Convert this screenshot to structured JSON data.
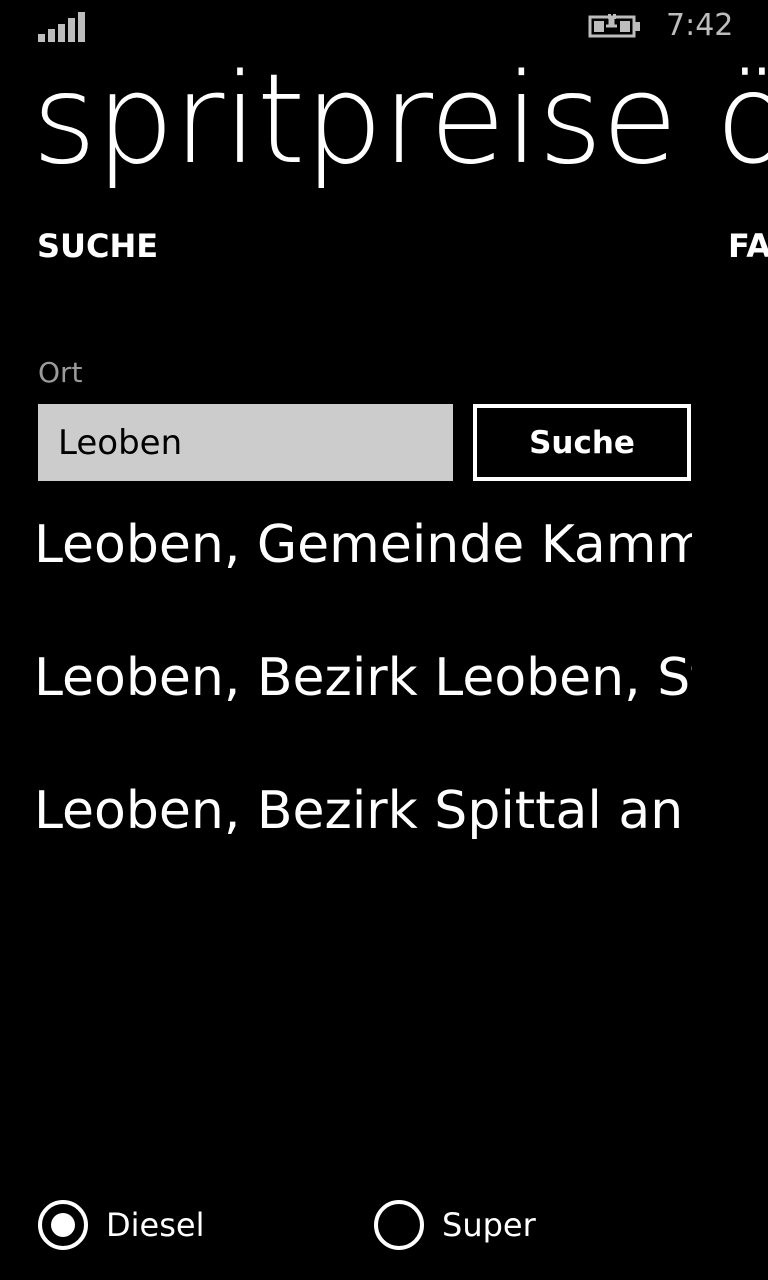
{
  "status_bar": {
    "time": "7:42",
    "signal_icon": "signal-strength-icon",
    "battery_icon": "battery-charging-icon"
  },
  "app": {
    "title": "spritpreise ö"
  },
  "pivot": {
    "active_tab": "SUCHE",
    "next_tab": "FA"
  },
  "search": {
    "label": "Ort",
    "value": "Leoben",
    "button_label": "Suche"
  },
  "results": [
    "Leoben, Gemeinde Kamm",
    "Leoben, Bezirk Leoben, St",
    "Leoben, Bezirk Spittal an d"
  ],
  "fuel_type": {
    "options": [
      {
        "label": "Diesel",
        "selected": true
      },
      {
        "label": "Super",
        "selected": false
      }
    ]
  },
  "colors": {
    "background": "#000000",
    "foreground": "#ffffff",
    "input_background": "#cccccc",
    "label_gray": "#9a9a9a"
  }
}
